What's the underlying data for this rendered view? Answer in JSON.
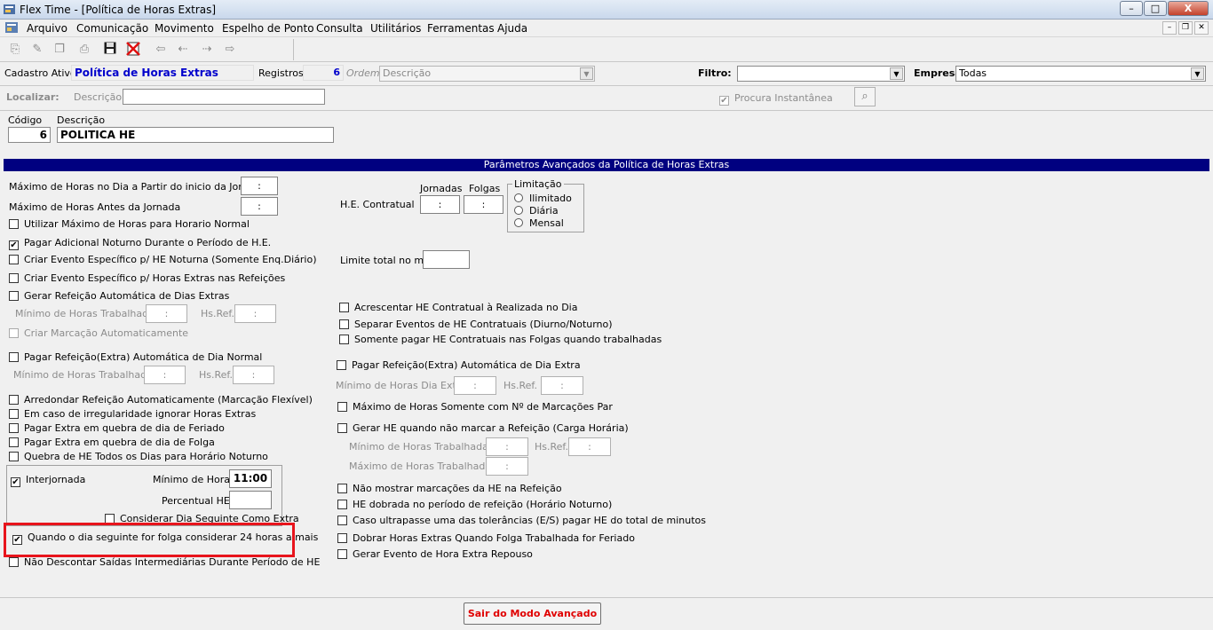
{
  "window": {
    "title": "Flex Time - [Política de Horas Extras]",
    "controls": {
      "minimize": "–",
      "maximize": "□",
      "close": "X"
    }
  },
  "menu": [
    "Arquivo",
    "Comunicação",
    "Movimento",
    "Espelho de Ponto",
    "Consulta",
    "Utilitários",
    "Ferramentas",
    "Ajuda"
  ],
  "toolbar_icons": [
    "new-record-icon",
    "edit-record-icon",
    "copy-record-icon",
    "print-icon",
    "save-icon",
    "cancel-icon",
    "first-record-icon",
    "previous-record-icon",
    "next-record-icon",
    "last-record-icon"
  ],
  "header": {
    "cadastro_label": "Cadastro Ativo:",
    "cadastro_value": "Política de Horas Extras",
    "registros_label": "Registros:",
    "registros_value": "6",
    "ordem_label": "Ordem",
    "ordem_value": "Descrição",
    "filtro_label": "Filtro:",
    "filtro_value": "",
    "empresa_label": "Empresa:",
    "empresa_value": "Todas",
    "localizar_label": "Localizar:",
    "descricao_label": "Descrição",
    "localizar_value": "",
    "procura_label": "Procura Instantânea",
    "procura_checked": true
  },
  "record": {
    "codigo_label": "Código",
    "codigo_value": "6",
    "descricao_label": "Descrição",
    "descricao_value": "POLITICA HE"
  },
  "section_title": "Parâmetros Avançados da Política de Horas Extras",
  "left": {
    "max_horas_dia_label": "Máximo de Horas no Dia a Partir do inicio da Jornada",
    "max_horas_dia_value": ":",
    "max_horas_antes_label": "Máximo de Horas Antes da Jornada",
    "max_horas_antes_value": ":",
    "util_max_horas": "Utilizar Máximo de Horas para Horario Normal",
    "pagar_adicional_noturno": "Pagar Adicional Noturno Durante o Período de H.E.",
    "criar_evento_noturna": "Criar Evento Específico p/ HE Noturna  (Somente Enq.Diário)",
    "criar_evento_refeicoes": "Criar Evento Específico p/ Horas Extras nas Refeições",
    "gerar_refeicao_extras": "Gerar Refeição Automática de Dias Extras",
    "min_horas_trab_label": "Mínimo de Horas Trabalhadas",
    "min_horas_trab_value": ":",
    "hs_ref_label": "Hs.Ref.",
    "hs_ref_value": ":",
    "criar_marcacao": "Criar Marcação Automaticamente",
    "pagar_refeicao_normal": "Pagar Refeição(Extra) Automática de Dia Normal",
    "min_horas_trab2_label": "Mínimo de Horas Trabalhadas",
    "min_horas_trab2_value": ":",
    "hs_ref2_label": "Hs.Ref.",
    "hs_ref2_value": ":",
    "arredondar_refeicao": "Arredondar Refeição Automaticamente (Marcação Flexível)",
    "irregularidade": "Em caso de irregularidade ignorar Horas Extras",
    "extra_feriado": "Pagar Extra em quebra de dia de Feriado",
    "extra_folga": "Pagar Extra em quebra de dia de Folga",
    "quebra_noturno": "Quebra de HE Todos os Dias para Horário Noturno",
    "interjornada": "Interjornada",
    "min_horas_label": "Mínimo de Horas",
    "min_horas_value": "11:00",
    "percentual_label": "Percentual HE",
    "percentual_value": "",
    "considerar_dia_seguinte": "Considerar Dia Seguinte Como Extra",
    "folga_24h": "Quando o dia seguinte for folga considerar 24 horas a mais",
    "nao_descontar": "Não Descontar Saídas Intermediárias Durante Período de HE"
  },
  "right": {
    "jornadas_label": "Jornadas",
    "folgas_label": "Folgas",
    "he_contratual_label": "H.E. Contratual",
    "jornadas_value": ":",
    "folgas_value": ":",
    "limitacao_label": "Limitação",
    "limitacao_options": [
      "Ilimitado",
      "Diária",
      "Mensal"
    ],
    "limite_total_label": "Limite total no mês",
    "limite_total_value": "",
    "acrescentar_he": "Acrescentar HE Contratual à Realizada no Dia",
    "separar_eventos": "Separar Eventos de HE Contratuais (Diurno/Noturno)",
    "somente_folgas": "Somente pagar HE Contratuais nas Folgas quando trabalhadas",
    "pagar_refeicao_extra": "Pagar Refeição(Extra) Automática de Dia Extra",
    "min_horas_dia_extra_label": "Mínimo de Horas Dia Extra",
    "min_horas_dia_extra_value": ":",
    "hs_ref_label": "Hs.Ref.",
    "hs_ref_value": ":",
    "max_horas_par": "Máximo de Horas Somente com Nº de Marcações Par",
    "gerar_he_refeicao": "Gerar HE quando não marcar a Refeição (Carga Horária)",
    "min_horas_trab_label": "Mínimo de Horas Trabalhadas",
    "min_horas_trab_value": ":",
    "hs_ref2_label": "Hs.Ref.",
    "hs_ref2_value": ":",
    "min_horas_trab2_label": "Máximo de Horas Trabalhadas",
    "min_horas_trab2_value": ":",
    "nao_mostrar": "Não mostrar marcações da HE na Refeição",
    "he_dobrada": "HE dobrada no período de refeição (Horário Noturno)",
    "caso_ultrapasse": "Caso ultrapasse uma das tolerâncias (E/S) pagar HE do total de minutos",
    "dobrar_feriado": "Dobrar Horas Extras Quando Folga Trabalhada for Feriado",
    "gerar_repouso": "Gerar Evento de Hora Extra Repouso"
  },
  "footer": {
    "sair_button": "Sair do Modo Avançado"
  },
  "colors": {
    "banner": "#000080",
    "cadastro_text": "#0000cc",
    "sair_text": "#e00000",
    "highlight": "#e8141c"
  }
}
